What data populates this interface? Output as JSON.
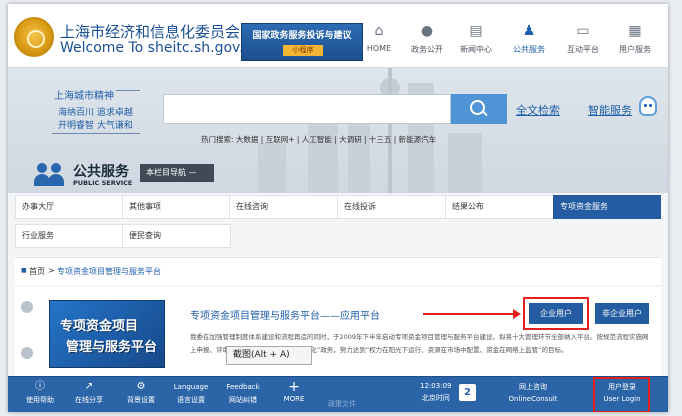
{
  "header": {
    "site_name_cn": "上海市经济和信息化委员会",
    "site_name_en": "Welcome To sheitc.sh.gov.cn",
    "promo_title": "国家政务服务投诉与建议",
    "promo_sub": "小程序",
    "nav": [
      {
        "label": "HOME",
        "icon": "home-icon",
        "glyph": "⌂",
        "active": false
      },
      {
        "label": "政务公开",
        "icon": "chat-icon",
        "glyph": "●",
        "active": false
      },
      {
        "label": "新闻中心",
        "icon": "book-icon",
        "glyph": "▤",
        "active": false
      },
      {
        "label": "公共服务",
        "icon": "people-icon",
        "glyph": "♟",
        "active": true
      },
      {
        "label": "互动平台",
        "icon": "monitor-icon",
        "glyph": "▭",
        "active": false
      },
      {
        "label": "用户服务",
        "icon": "user-icon",
        "glyph": "▦",
        "active": false
      }
    ]
  },
  "banner": {
    "motto_title": "上海城市精神",
    "motto_line1": "海纳百川  追求卓越",
    "motto_line2": "开明睿智  大气谦和",
    "search_placeholder": "",
    "fulltext": "全文检索",
    "smart_service": "智能服务",
    "hot_search": "热门搜索: 大数据 | 互联网+ | 人工智能 | 大调研 | 十三五 | 新能源汽车",
    "service_title": "公共服务",
    "service_en": "PUBLIC SERVICE",
    "guide": "本栏目导航 —"
  },
  "menu": {
    "row1": [
      "办事大厅",
      "其他事项",
      "在线咨询",
      "在线投诉",
      "结果公布",
      "专项资金服务"
    ],
    "row2": [
      "行业服务",
      "便民查询"
    ],
    "active": "专项资金服务"
  },
  "breadcrumb": {
    "home": "首页",
    "sep": ">",
    "current": "专项资金项目管理与服务平台"
  },
  "content": {
    "thumb_line1": "专项资金项目",
    "thumb_line2": "管理与服务平台",
    "platform_title": "专项资金项目管理与服务平台——应用平台",
    "enterprise_user": "企业用户",
    "non_enterprise_user": "非企业用户",
    "description": "我委在加强管理制度体系建设和流程再造的同时，于2009年下半年启动专项资金项目管理与服务平台建设。拟将十大管理环节全部纳入平台。按规范流程实施网上申报、评审、公示、拨付、监督等“阳光化”政务，努力达到“权力在阳光下运行、资源在市场中配置、资金在网络上监管”的目标。",
    "screenshot_tip": "截图(Alt + A)"
  },
  "toolbar": {
    "items": [
      {
        "label": "使用帮助",
        "icon": "info-icon",
        "glyph": "ⓘ",
        "top": ""
      },
      {
        "label": "在线分享",
        "icon": "share-icon",
        "glyph": "↗",
        "top": ""
      },
      {
        "label": "背景设置",
        "icon": "gear-icon",
        "glyph": "⚙",
        "top": ""
      },
      {
        "label": "语言设置",
        "icon": "language-icon",
        "glyph": "",
        "top": "Language"
      },
      {
        "label": "网站纠错",
        "icon": "feedback-icon",
        "glyph": "",
        "top": "Feedback"
      },
      {
        "label": "MORE",
        "icon": "plus-icon",
        "glyph": "+",
        "top": ""
      }
    ],
    "watermark": "政策文件",
    "time": "12:03:09",
    "time_label": "北京时间",
    "date_day": "2",
    "consult_cn": "网上咨询",
    "consult_en": "OnlineConsult",
    "login_cn": "用户登录",
    "login_en": "User Login"
  }
}
